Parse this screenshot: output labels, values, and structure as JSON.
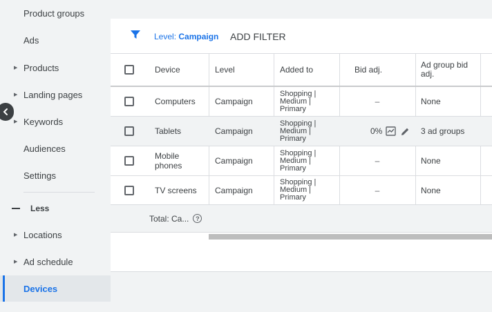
{
  "sidebar": {
    "items": [
      {
        "label": "Product groups",
        "expandable": false
      },
      {
        "label": "Ads",
        "expandable": false
      },
      {
        "label": "Products",
        "expandable": true
      },
      {
        "label": "Landing pages",
        "expandable": true
      },
      {
        "label": "Keywords",
        "expandable": true
      },
      {
        "label": "Audiences",
        "expandable": false
      },
      {
        "label": "Settings",
        "expandable": false
      }
    ],
    "less_label": "Less",
    "more_items": [
      {
        "label": "Locations",
        "expandable": true
      },
      {
        "label": "Ad schedule",
        "expandable": true
      },
      {
        "label": "Devices",
        "expandable": false,
        "active": true
      }
    ]
  },
  "filter": {
    "level_prefix": "Level: ",
    "level_value": "Campaign",
    "add_filter": "ADD FILTER"
  },
  "table": {
    "headers": {
      "device": "Device",
      "level": "Level",
      "added_to": "Added to",
      "bid_adj": "Bid adj.",
      "ad_group_bid_adj_1": "Ad group bid",
      "ad_group_bid_adj_2": "adj."
    },
    "rows": [
      {
        "device": "Computers",
        "level": "Campaign",
        "added_to": [
          "Shopping |",
          "Medium |",
          "Primary"
        ],
        "bid_adj": "–",
        "ad_group_bid_adj": "None"
      },
      {
        "device": "Tablets",
        "level": "Campaign",
        "added_to": [
          "Shopping |",
          "Medium |",
          "Primary"
        ],
        "bid_adj": "0%",
        "ad_group_bid_adj": "3 ad groups"
      },
      {
        "device": "Mobile phones",
        "device_lines": [
          "Mobile",
          "phones"
        ],
        "level": "Campaign",
        "added_to": [
          "Shopping |",
          "Medium |",
          "Primary"
        ],
        "bid_adj": "–",
        "ad_group_bid_adj": "None"
      },
      {
        "device": "TV screens",
        "level": "Campaign",
        "added_to": [
          "Shopping |",
          "Medium |",
          "Primary"
        ],
        "bid_adj": "–",
        "ad_group_bid_adj": "None"
      }
    ],
    "total_label": "Total: Ca..."
  },
  "colors": {
    "accent": "#1a73e8",
    "sidebar_bg": "#f1f3f4",
    "text": "#3c4043"
  },
  "icons": {
    "filter": "filter-funnel-icon",
    "collapse": "chevron-left-icon",
    "chart": "trend-chart-icon",
    "edit": "pencil-icon",
    "help": "help-circle-icon"
  }
}
